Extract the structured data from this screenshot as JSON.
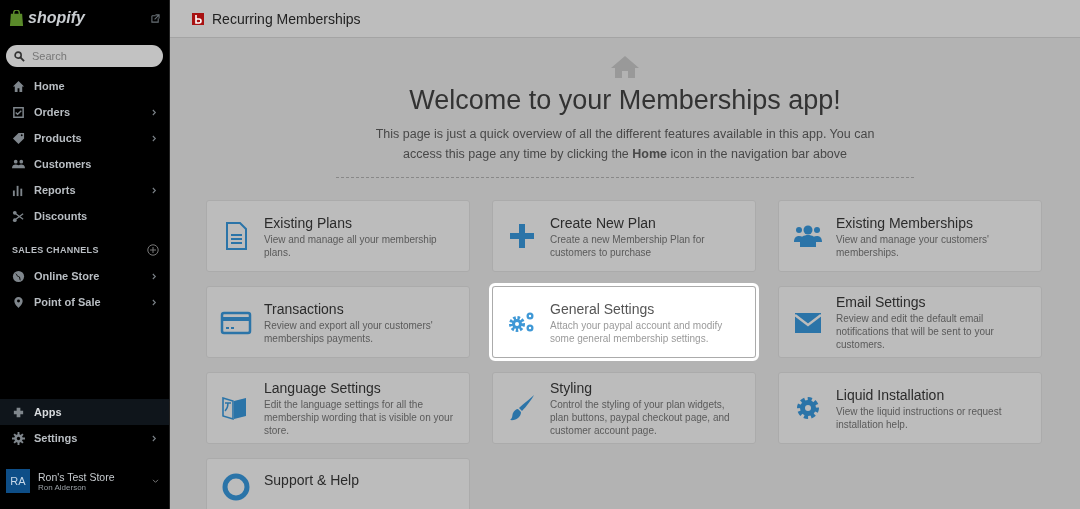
{
  "sidebar": {
    "brand": "shopify",
    "search": {
      "placeholder": "Search"
    },
    "nav": [
      {
        "label": "Home",
        "expandable": false,
        "selected": false
      },
      {
        "label": "Orders",
        "expandable": true,
        "selected": false
      },
      {
        "label": "Products",
        "expandable": true,
        "selected": false
      },
      {
        "label": "Customers",
        "expandable": false,
        "selected": false
      },
      {
        "label": "Reports",
        "expandable": true,
        "selected": false
      },
      {
        "label": "Discounts",
        "expandable": false,
        "selected": false
      }
    ],
    "section_title": "SALES CHANNELS",
    "channels": [
      {
        "label": "Online Store",
        "expandable": true,
        "selected": false
      },
      {
        "label": "Point of Sale",
        "expandable": true,
        "selected": false
      }
    ],
    "bottom": [
      {
        "label": "Apps",
        "expandable": false,
        "selected": true
      },
      {
        "label": "Settings",
        "expandable": true,
        "selected": false
      }
    ],
    "account": {
      "initials": "RA",
      "store": "Ron's Test Store",
      "user": "Ron Alderson"
    }
  },
  "header": {
    "title": "Recurring Memberships"
  },
  "welcome": {
    "heading": "Welcome to your Memberships app!",
    "intro": "This page is just a quick overview of all the different features available in this app. You can access this page any time by clicking the **Home** icon in the navigation bar above"
  },
  "cards": [
    {
      "title": "Existing Plans",
      "description": "View and manage all your membership plans.",
      "highlighted": false
    },
    {
      "title": "Create New Plan",
      "description": "Create a new Membership Plan for customers to purchase",
      "highlighted": false
    },
    {
      "title": "Existing Memberships",
      "description": "View and manage your customers' memberships.",
      "highlighted": false
    },
    {
      "title": "Transactions",
      "description": "Review and export all your customers' memberships payments.",
      "highlighted": false
    },
    {
      "title": "General Settings",
      "description": "Attach your paypal account and modify some general membership settings.",
      "highlighted": true
    },
    {
      "title": "Email Settings",
      "description": "Review and edit the default email notifications that will be sent to your customers.",
      "highlighted": false
    },
    {
      "title": "Language Settings",
      "description": "Edit the language settings for all the membership wording that is visible on your store.",
      "highlighted": false
    },
    {
      "title": "Styling",
      "description": "Control the styling of your plan widgets, plan buttons, paypal checkout page, and customer account page.",
      "highlighted": false
    },
    {
      "title": "Liquid Installation",
      "description": "View the liquid instructions or request installation help.",
      "highlighted": false
    },
    {
      "title": "Support & Help",
      "highlighted": false
    }
  ]
}
